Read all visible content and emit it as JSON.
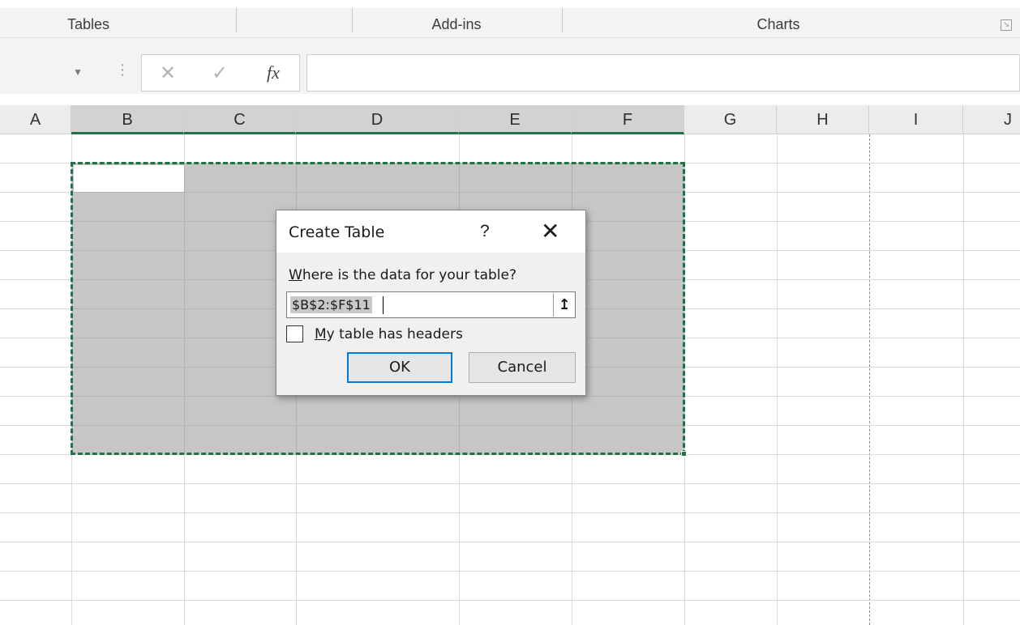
{
  "ribbon": {
    "groups": [
      "Tables",
      "Add-ins",
      "Charts"
    ]
  },
  "formula_bar": {
    "cancel_icon": "close-icon",
    "enter_icon": "checkmark-icon",
    "function_label": "fx",
    "content": ""
  },
  "columns": [
    "A",
    "B",
    "C",
    "D",
    "E",
    "F",
    "G",
    "H",
    "I",
    "J"
  ],
  "selected_columns": [
    "B",
    "C",
    "D",
    "E",
    "F"
  ],
  "dialog": {
    "title": "Create Table",
    "help": "?",
    "close": "✕",
    "prompt_underlined": "W",
    "prompt_rest": "here is the data for your table?",
    "range_value": "$B$2:$F$11",
    "collapse_icon": "↥",
    "headers_checked": false,
    "headers_underlined": "M",
    "headers_rest": "y table has headers",
    "ok_label": "OK",
    "cancel_label": "Cancel"
  },
  "colors": {
    "selection_border": "#217346",
    "ok_button_border": "#0078d7",
    "selection_fill": "#c6c6c6"
  }
}
